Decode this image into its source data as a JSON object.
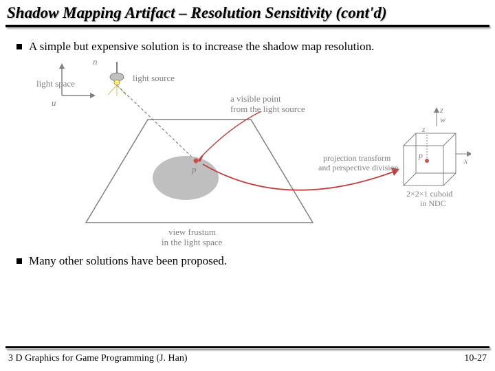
{
  "title": "Shadow Mapping Artifact – Resolution Sensitivity (cont'd)",
  "bullets": [
    "A  simple but expensive solution is to increase the shadow map resolution.",
    "Many other solutions have been proposed."
  ],
  "figure": {
    "light_space_u": "light space",
    "axis_u_left": "u",
    "axis_n": "n",
    "light_source": "light source",
    "visible_point": "a visible point from the light source",
    "p_label": "p",
    "proj_label": "projection transform and perspective division",
    "frustum_label": "view frustum in the light space",
    "ndc_axes": {
      "z": "z",
      "w": "w",
      "x": "x"
    },
    "ndc_p": "p",
    "ndc_label": "2×2×1 cuboid in NDC"
  },
  "footer": {
    "left": "3 D Graphics for Game Programming (J. Han)",
    "right": "10-27"
  }
}
